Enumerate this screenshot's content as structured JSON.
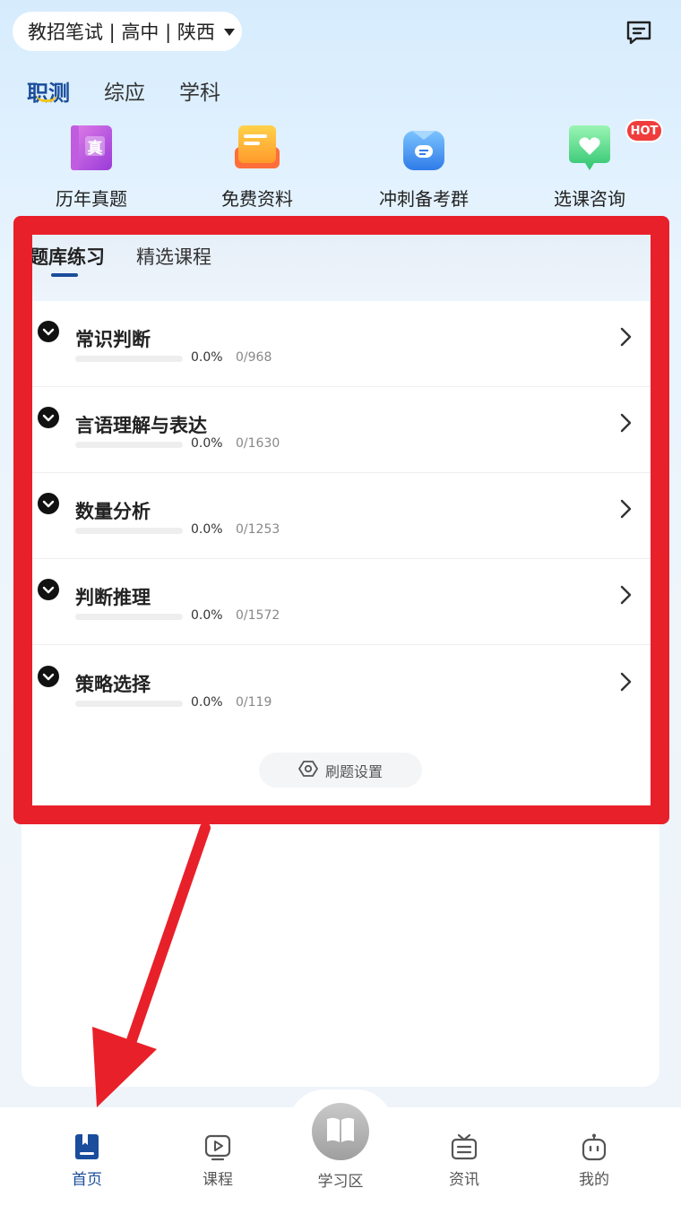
{
  "header": {
    "selector_label": "教招笔试 | 高中 | 陕西",
    "message_icon": "message-icon"
  },
  "main_tabs": [
    {
      "label": "职测",
      "active": true
    },
    {
      "label": "综应",
      "active": false
    },
    {
      "label": "学科",
      "active": false
    }
  ],
  "quick_actions": [
    {
      "label": "历年真题",
      "icon": "past-exams-book-icon",
      "icon_text": "真"
    },
    {
      "label": "免费资料",
      "icon": "free-materials-icon"
    },
    {
      "label": "冲刺备考群",
      "icon": "study-group-icon"
    },
    {
      "label": "选课咨询",
      "icon": "course-consult-heart-icon"
    }
  ],
  "hot_badge": "HOT",
  "sub_tabs": [
    {
      "label": "题库练习",
      "active": true
    },
    {
      "label": "精选课程",
      "active": false
    }
  ],
  "question_bank": [
    {
      "title": "常识判断",
      "progress": 0.0,
      "percent_text": "0.0%",
      "count_text": "0/968"
    },
    {
      "title": "言语理解与表达",
      "progress": 0.0,
      "percent_text": "0.0%",
      "count_text": "0/1630"
    },
    {
      "title": "数量分析",
      "progress": 0.0,
      "percent_text": "0.0%",
      "count_text": "0/1253"
    },
    {
      "title": "判断推理",
      "progress": 0.0,
      "percent_text": "0.0%",
      "count_text": "0/1572"
    },
    {
      "title": "策略选择",
      "progress": 0.0,
      "percent_text": "0.0%",
      "count_text": "0/119"
    }
  ],
  "settings_button": "刷题设置",
  "bottom_nav": [
    {
      "label": "首页",
      "icon": "home-book-icon",
      "active": true
    },
    {
      "label": "课程",
      "icon": "course-play-icon",
      "active": false
    },
    {
      "label": "学习区",
      "icon": "study-book-icon",
      "active": false
    },
    {
      "label": "资讯",
      "icon": "news-icon",
      "active": false
    },
    {
      "label": "我的",
      "icon": "profile-robot-icon",
      "active": false
    }
  ],
  "colors": {
    "accent": "#1a4d9c",
    "highlight_red": "#e8202a",
    "hot_badge": "#f03c3c"
  }
}
